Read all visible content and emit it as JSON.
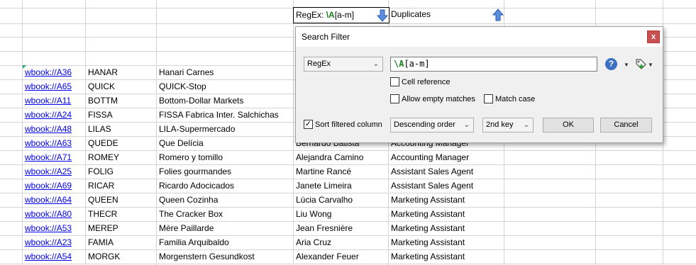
{
  "header": {
    "regex_label": "RegEx: ",
    "regex_pattern": "\\A",
    "regex_rest": "[a-m]",
    "duplicates_label": "Duplicates"
  },
  "rows": [
    {
      "link": "wbook://A36",
      "code": "HANAR",
      "name": "Hanari Carnes",
      "contact": "",
      "title": ""
    },
    {
      "link": "wbook://A65",
      "code": "QUICK",
      "name": "QUICK-Stop",
      "contact": "",
      "title": ""
    },
    {
      "link": "wbook://A11",
      "code": "BOTTM",
      "name": "Bottom-Dollar Markets",
      "contact": "",
      "title": ""
    },
    {
      "link": "wbook://A24",
      "code": "FISSA",
      "name": "FISSA Fabrica Inter. Salchichas",
      "contact": "",
      "title": ""
    },
    {
      "link": "wbook://A48",
      "code": "LILAS",
      "name": "LILA-Supermercado",
      "contact": "",
      "title": ""
    },
    {
      "link": "wbook://A63",
      "code": "QUEDE",
      "name": "Que Delícia",
      "contact": "Bernardo Batista",
      "title": "Accounting Manager"
    },
    {
      "link": "wbook://A71",
      "code": "ROMEY",
      "name": "Romero y tomillo",
      "contact": "Alejandra Camino",
      "title": "Accounting Manager"
    },
    {
      "link": "wbook://A25",
      "code": "FOLIG",
      "name": "Folies gourmandes",
      "contact": "Martine Rancé",
      "title": "Assistant Sales Agent"
    },
    {
      "link": "wbook://A69",
      "code": "RICAR",
      "name": "Ricardo Adocicados",
      "contact": "Janete Limeira",
      "title": "Assistant Sales Agent"
    },
    {
      "link": "wbook://A64",
      "code": "QUEEN",
      "name": "Queen Cozinha",
      "contact": "Lúcia Carvalho",
      "title": "Marketing Assistant"
    },
    {
      "link": "wbook://A80",
      "code": "THECR",
      "name": "The Cracker Box",
      "contact": "Liu Wong",
      "title": "Marketing Assistant"
    },
    {
      "link": "wbook://A53",
      "code": "MEREP",
      "name": "Mère Paillarde",
      "contact": "Jean Fresnière",
      "title": "Marketing Assistant"
    },
    {
      "link": "wbook://A23",
      "code": "FAMIA",
      "name": "Familia Arquibaldo",
      "contact": "Aria Cruz",
      "title": "Marketing Assistant"
    },
    {
      "link": "wbook://A54",
      "code": "MORGK",
      "name": "Morgenstern Gesundkost",
      "contact": "Alexander Feuer",
      "title": "Marketing Assistant"
    }
  ],
  "dialog": {
    "title": "Search Filter",
    "close_label": "x",
    "mode_value": "RegEx",
    "pattern_bold": "\\A",
    "pattern_rest": "[a-m]",
    "help_label": "?",
    "cell_reference_label": "Cell reference",
    "allow_empty_label": "Allow empty matches",
    "match_case_label": "Match case",
    "sort_filtered_label": "Sort filtered column",
    "sort_filtered_check": "✓",
    "order_value": "Descending order",
    "key_value": "2nd key",
    "ok_label": "OK",
    "cancel_label": "Cancel"
  },
  "colors": {
    "regex_green": "#1a7f1a",
    "link_blue": "#0000ee",
    "arrow_blue": "#3d7bd6",
    "close_red": "#c75050"
  }
}
